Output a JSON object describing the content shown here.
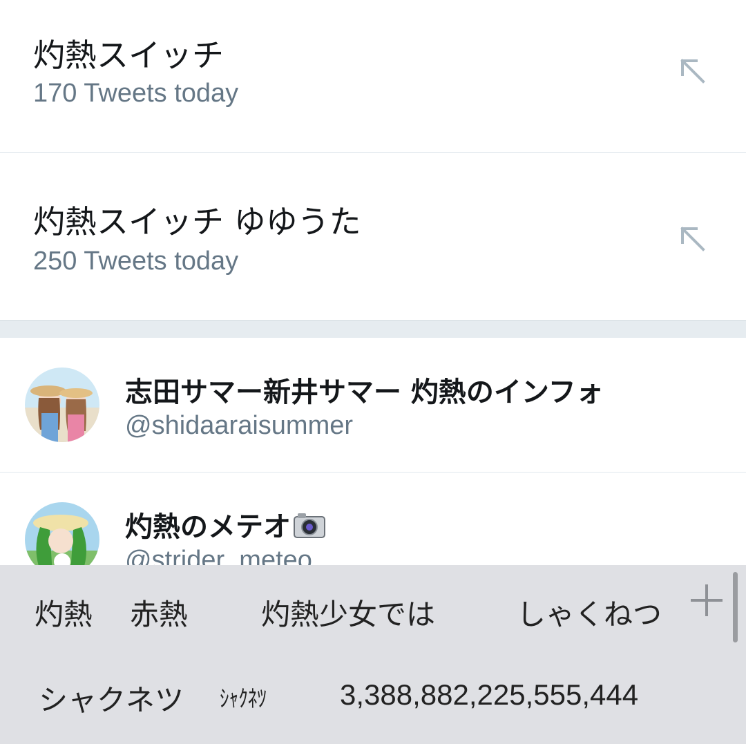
{
  "suggestions": [
    {
      "title": "灼熱スイッチ",
      "subtitle": "170 Tweets today",
      "icon": "arrow-up-left-icon"
    },
    {
      "title": "灼熱スイッチ ゆゆうた",
      "subtitle": "250 Tweets today",
      "icon": "arrow-up-left-icon"
    }
  ],
  "users": [
    {
      "name": "志田サマー新井サマー 灼熱のインフォ",
      "handle": "@shidaaraisummer",
      "avatar": "avatar-two-girls-beach"
    },
    {
      "name": "灼熱のメテオ",
      "name_icon": "camera-icon",
      "handle": "@strider_meteo",
      "avatar": "avatar-green-hair-girl"
    }
  ],
  "keyboard": {
    "row1": [
      "灼熱",
      "赤熱",
      "灼熱少女では",
      "しゃくねつ"
    ],
    "row2": [
      "シャクネツ",
      "ｼｬｸﾈﾂ",
      "3,388,882,225,555,444"
    ],
    "plus_icon": "plus-icon"
  },
  "colors": {
    "title_text": "#14171a",
    "secondary_text": "#657786",
    "divider": "#e1e8ed",
    "section_gap": "#e6ecf0",
    "keyboard_bg": "#dfe0e4",
    "arrow_icon": "#aab8c2"
  }
}
